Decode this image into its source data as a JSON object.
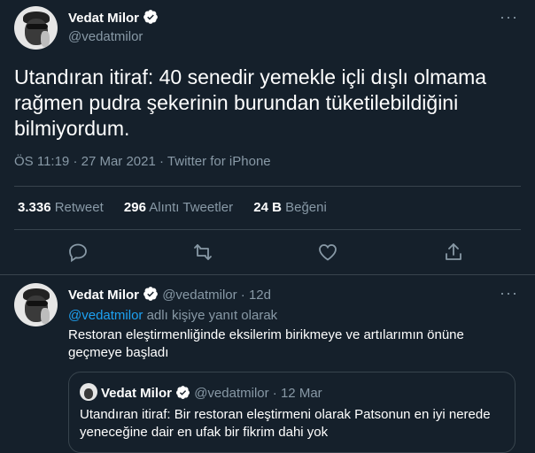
{
  "main_tweet": {
    "author_name": "Vedat Milor",
    "handle": "@vedatmilor",
    "text": "Utandıran itiraf: 40 senedir yemekle içli dışlı olmama rağmen pudra şekerinin burundan tüketilebildiğini bilmiyordum.",
    "time": "ÖS 11:19",
    "date": "27 Mar 2021",
    "source": "Twitter for iPhone",
    "sep": "·"
  },
  "stats": {
    "retweets_count": "3.336",
    "retweets_label": "Retweet",
    "quotes_count": "296",
    "quotes_label": "Alıntı Tweetler",
    "likes_count": "24 B",
    "likes_label": "Beğeni"
  },
  "reply_tweet": {
    "author_name": "Vedat Milor",
    "handle": "@vedatmilor",
    "age": "12d",
    "sep": "·",
    "reply_to_handle": "@vedatmilor",
    "reply_to_suffix": "adlı kişiye yanıt olarak",
    "text": "Restoran eleştirmenliğinde eksilerim birikmeye ve artılarımın önüne geçmeye başladı"
  },
  "quoted_tweet": {
    "author_name": "Vedat Milor",
    "handle": "@vedatmilor",
    "date": "12 Mar",
    "sep": "·",
    "text": "Utandıran itiraf: Bir restoran eleştirmeni olarak Patsonun en iyi nerede yeneceğine dair en ufak bir fikrim dahi yok"
  },
  "icons": {
    "more": "more-icon",
    "verified": "verified-icon",
    "reply": "reply-icon",
    "retweet": "retweet-icon",
    "like": "like-icon",
    "share": "share-icon"
  },
  "colors": {
    "background": "#15202b",
    "text": "#ffffff",
    "muted": "#8899a6",
    "accent": "#1da1f2",
    "border": "#38444d"
  }
}
